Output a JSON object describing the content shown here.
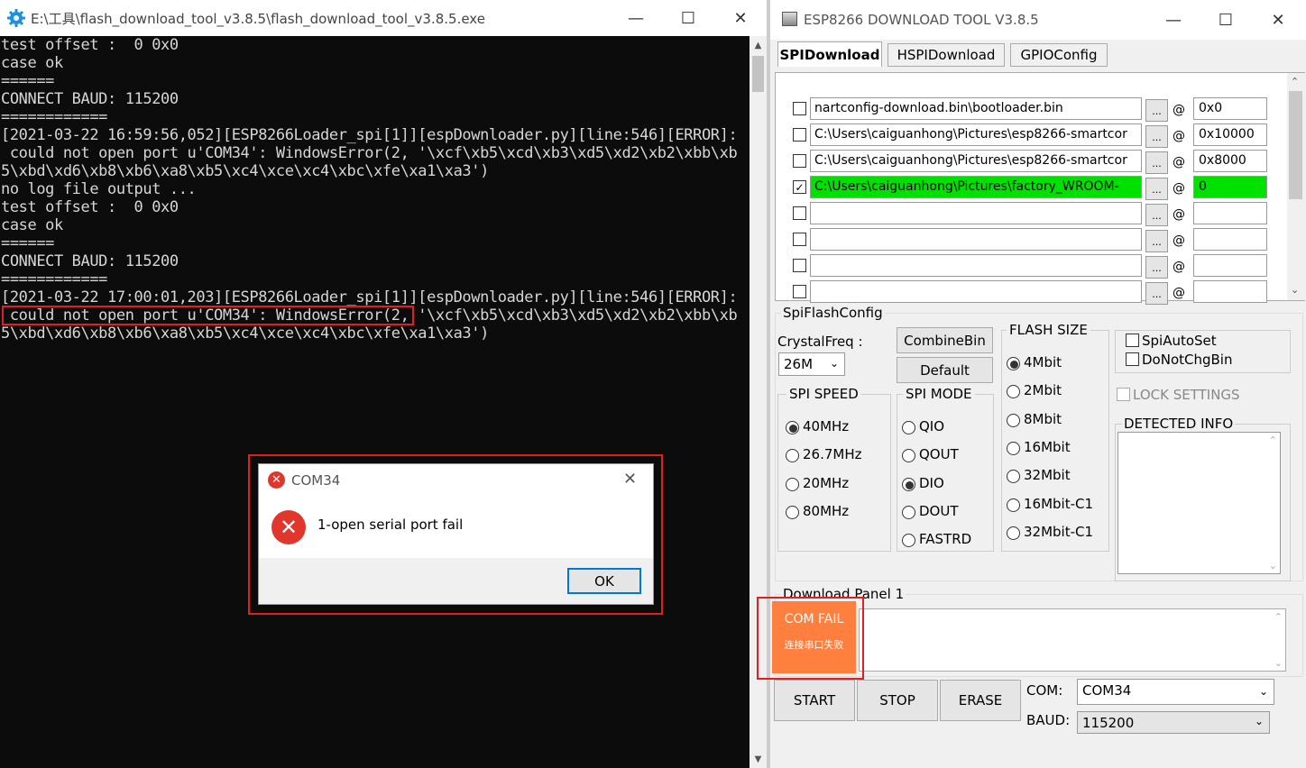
{
  "console": {
    "title": "E:\\工具\\flash_download_tool_v3.8.5\\flash_download_tool_v3.8.5.exe",
    "lines": [
      "test offset :  0 0x0",
      "case ok",
      "======",
      "CONNECT BAUD: 115200",
      "============",
      "[2021-03-22 16:59:56,052][ESP8266Loader_spi[1]][espDownloader.py][line:546][ERROR]:",
      " could not open port u'COM34': WindowsError(2, '\\xcf\\xb5\\xcd\\xb3\\xd5\\xd2\\xb2\\xbb\\xb",
      "5\\xbd\\xd6\\xb8\\xb6\\xa8\\xb5\\xc4\\xce\\xc4\\xbc\\xfe\\xa1\\xa3')",
      "no log file output ...",
      "test offset :  0 0x0",
      "case ok",
      "======",
      "CONNECT BAUD: 115200",
      "============",
      "[2021-03-22 17:00:01,203][ESP8266Loader_spi[1]][espDownloader.py][line:546][ERROR]:",
      " could not open port u'COM34': WindowsError(2, '\\xcf\\xb5\\xcd\\xb3\\xd5\\xd2\\xb2\\xbb\\xb",
      "5\\xbd\\xd6\\xb8\\xb6\\xa8\\xb5\\xc4\\xce\\xc4\\xbc\\xfe\\xa1\\xa3')"
    ]
  },
  "dialog": {
    "title": "COM34",
    "message": "1-open serial port fail",
    "ok_label": "OK"
  },
  "tool": {
    "title": "ESP8266 DOWNLOAD TOOL V3.8.5",
    "tabs": [
      "SPIDownload",
      "HSPIDownload",
      "GPIOConfig"
    ],
    "files": [
      {
        "checked": false,
        "path": "nartconfig-download.bin\\bootloader.bin",
        "addr": "0x0",
        "highlight": false
      },
      {
        "checked": false,
        "path": "C:\\Users\\caiguanhong\\Pictures\\esp8266-smartcor",
        "addr": "0x10000",
        "highlight": false
      },
      {
        "checked": false,
        "path": "C:\\Users\\caiguanhong\\Pictures\\esp8266-smartcor",
        "addr": "0x8000",
        "highlight": false
      },
      {
        "checked": true,
        "path": "C:\\Users\\caiguanhong\\Pictures\\factory_WROOM-",
        "addr": "0",
        "highlight": true
      },
      {
        "checked": false,
        "path": "",
        "addr": "",
        "highlight": false
      },
      {
        "checked": false,
        "path": "",
        "addr": "",
        "highlight": false
      },
      {
        "checked": false,
        "path": "",
        "addr": "",
        "highlight": false
      },
      {
        "checked": false,
        "path": "",
        "addr": "",
        "highlight": false
      }
    ],
    "dots_label": "...",
    "at_label": "@",
    "spi_flash_config": "SpiFlashConfig",
    "crystal_label": "CrystalFreq :",
    "crystal_value": "26M",
    "combine_label": "CombineBin",
    "default_label": "Default",
    "spi_speed_label": "SPI SPEED",
    "spi_speed": [
      "40MHz",
      "26.7MHz",
      "20MHz",
      "80MHz"
    ],
    "spi_mode_label": "SPI MODE",
    "spi_mode": [
      "QIO",
      "QOUT",
      "DIO",
      "DOUT",
      "FASTRD"
    ],
    "flash_size_label": "FLASH SIZE",
    "flash_size": [
      "4Mbit",
      "2Mbit",
      "8Mbit",
      "16Mbit",
      "32Mbit",
      "16Mbit-C1",
      "32Mbit-C1"
    ],
    "spi_auto_set": "SpiAutoSet",
    "do_not_chg_bin": "DoNotChgBin",
    "lock_settings": "LOCK SETTINGS",
    "detected_info": "DETECTED INFO",
    "download_panel": "Download Panel 1",
    "com_fail": "COM FAIL",
    "com_fail_cn": "连接串口失败",
    "start_label": "START",
    "stop_label": "STOP",
    "erase_label": "ERASE",
    "com_label": "COM:",
    "com_value": "COM34",
    "baud_label": "BAUD:",
    "baud_value": "115200"
  }
}
